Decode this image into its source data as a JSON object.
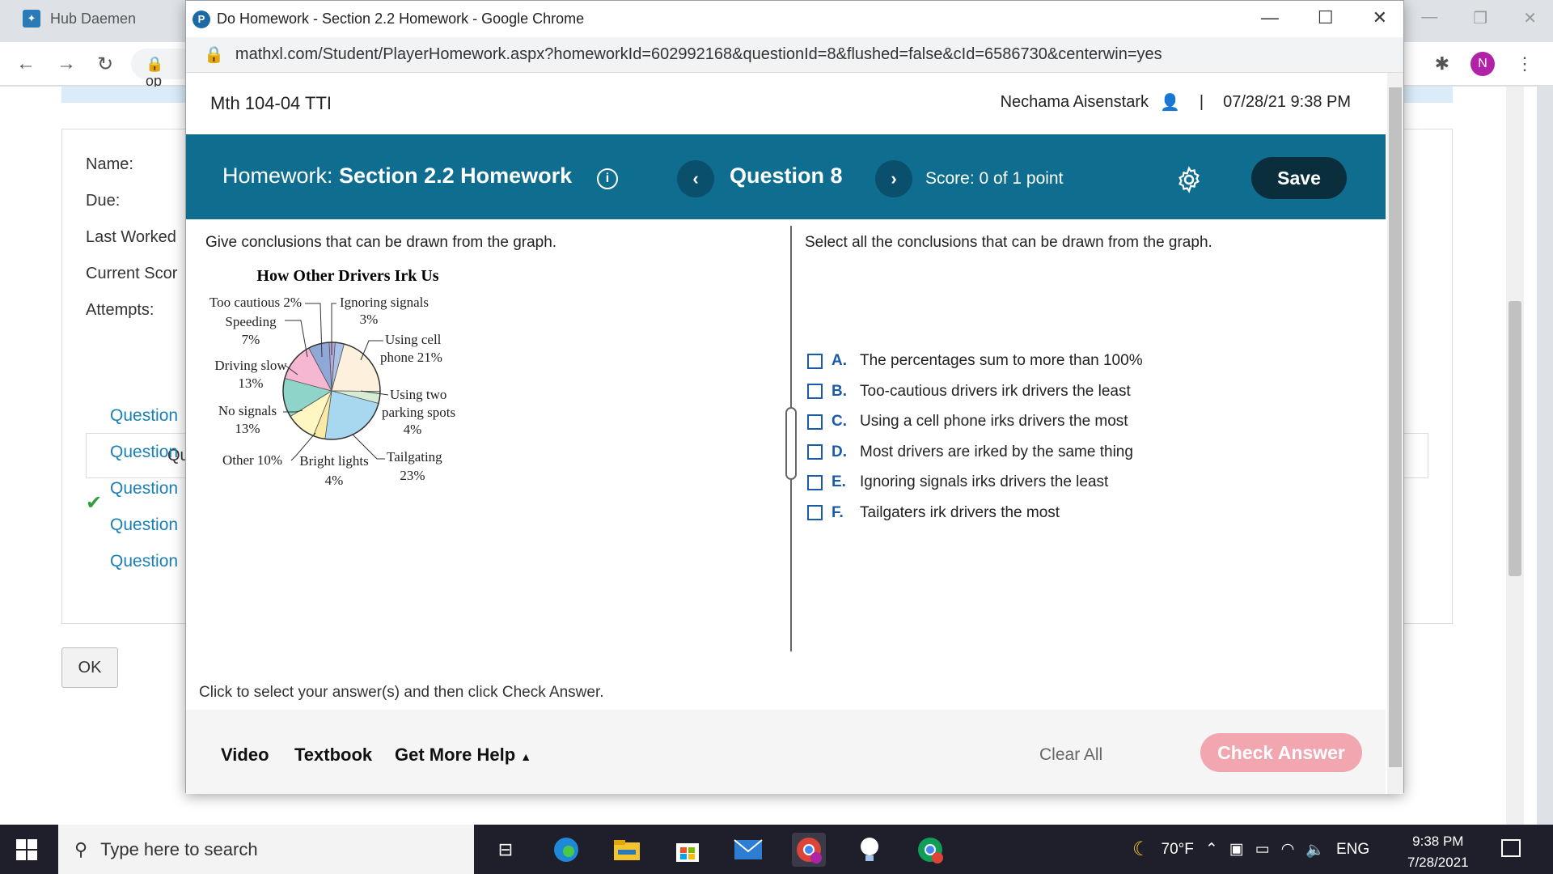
{
  "background": {
    "tab_title": "Hub Daemen",
    "address_stub": "op",
    "profile_letter": "N",
    "labels": [
      "Name:",
      "Due:",
      "Last Worked",
      "Current Scor",
      "Attempts:"
    ],
    "questions_header": "Qu",
    "question_links": [
      "Question",
      "Question",
      "Question",
      "Question",
      "Question"
    ],
    "ok_label": "OK"
  },
  "popup": {
    "window_title": "Do Homework - Section 2.2 Homework - Google Chrome",
    "url": "mathxl.com/Student/PlayerHomework.aspx?homeworkId=602992168&questionId=8&flushed=false&cId=6586730&centerwin=yes",
    "course": "Mth 104-04 TTI",
    "user": "Nechama Aisenstark",
    "separator": "|",
    "datetime": "07/28/21 9:38 PM",
    "hw_prefix": "Homework:",
    "hw_name": "Section 2.2 Homework",
    "question_label": "Question 8",
    "score": "Score: 0 of 1 point",
    "save_label": "Save",
    "left_prompt": "Give conclusions that can be drawn from the graph.",
    "right_prompt": "Select all the conclusions that can be drawn from the graph.",
    "options": [
      {
        "letter": "A.",
        "text": "The percentages sum to more than 100%"
      },
      {
        "letter": "B.",
        "text": "Too-cautious drivers irk drivers the least"
      },
      {
        "letter": "C.",
        "text": "Using a cell phone irks drivers the most"
      },
      {
        "letter": "D.",
        "text": "Most drivers are irked by the same thing"
      },
      {
        "letter": "E.",
        "text": "Ignoring signals irks drivers the least"
      },
      {
        "letter": "F.",
        "text": "Tailgaters irk drivers the most"
      }
    ],
    "hint": "Click to select your answer(s) and then click Check Answer.",
    "footer": {
      "video": "Video",
      "textbook": "Textbook",
      "more_help": "Get More Help",
      "clear_all": "Clear All",
      "check_answer": "Check Answer"
    }
  },
  "chart_data": {
    "type": "pie",
    "title": "How Other Drivers Irk Us",
    "slices": [
      {
        "label": "Too cautious",
        "value": 2,
        "text": "Too cautious 2%",
        "color": "#b7a6d9"
      },
      {
        "label": "Ignoring signals",
        "value": 3,
        "text": "Ignoring signals 3%",
        "color": "#a9c3e8"
      },
      {
        "label": "Using cell phone",
        "value": 21,
        "text": "Using cell phone 21%",
        "color": "#fdf0dc"
      },
      {
        "label": "Using two parking spots",
        "value": 4,
        "text": "Using two parking spots 4%",
        "color": "#d7ecd4"
      },
      {
        "label": "Tailgating",
        "value": 23,
        "text": "Tailgating 23%",
        "color": "#a7d8f0"
      },
      {
        "label": "Bright lights",
        "value": 4,
        "text": "Bright lights 4%",
        "color": "#fbe9a6"
      },
      {
        "label": "Other",
        "value": 10,
        "text": "Other 10%",
        "color": "#fff7c2"
      },
      {
        "label": "No signals",
        "value": 13,
        "text": "No signals 13%",
        "color": "#8fd4c8"
      },
      {
        "label": "Driving slow",
        "value": 13,
        "text": "Driving slow 13%",
        "color": "#f6b7d2"
      },
      {
        "label": "Speeding",
        "value": 7,
        "text": "Speeding 7%",
        "color": "#8fa8d8"
      }
    ]
  },
  "taskbar": {
    "search_placeholder": "Type here to search",
    "weather": "70°F",
    "language": "ENG",
    "time": "9:38 PM",
    "date": "7/28/2021"
  },
  "colors": {
    "hw_bar": "#0f6e8f",
    "save_btn": "#0b2e3d",
    "check_answer_disabled": "#f2a6b0",
    "option_letter": "#1a5aa8"
  }
}
